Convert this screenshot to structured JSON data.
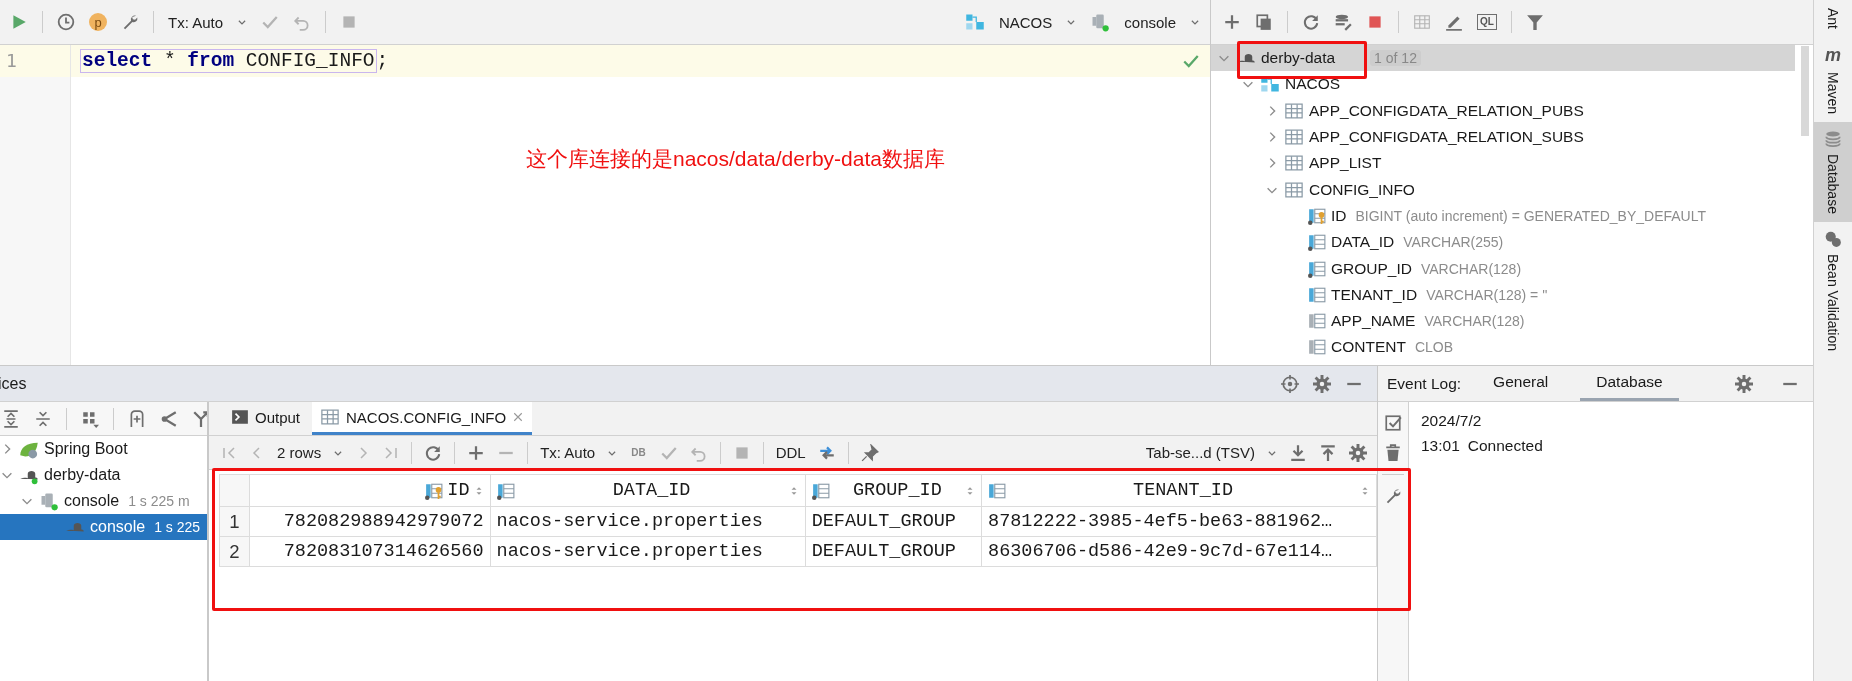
{
  "editor": {
    "toolbar": {
      "profile_badge": "p",
      "tx_mode": "Tx: Auto",
      "datasource": "NACOS",
      "session": "console"
    },
    "lines": [
      {
        "number": "1",
        "tokens": [
          {
            "kind": "keyword",
            "text": "select"
          },
          {
            "kind": "plain",
            "text": " * "
          },
          {
            "kind": "keyword",
            "text": "from"
          },
          {
            "kind": "plain",
            "text": " CONFIG_INFO"
          }
        ],
        "after": ";"
      }
    ],
    "annotation": "这个库连接的是nacos/data/derby-data数据库"
  },
  "database_tree": {
    "toolbar": {
      "console_badge": "QL"
    },
    "root": {
      "label": "derby-data",
      "count": "1 of 12",
      "kind": "datasource",
      "selected": true,
      "expanded": true,
      "children": [
        {
          "label": "NACOS",
          "kind": "schema",
          "expanded": true,
          "children": [
            {
              "label": "APP_CONFIGDATA_RELATION_PUBS",
              "kind": "table",
              "expanded": false
            },
            {
              "label": "APP_CONFIGDATA_RELATION_SUBS",
              "kind": "table",
              "expanded": false
            },
            {
              "label": "APP_LIST",
              "kind": "table",
              "expanded": false
            },
            {
              "label": "CONFIG_INFO",
              "kind": "table",
              "expanded": true,
              "children": [
                {
                  "label": "ID",
                  "type": "BIGINT (auto increment) = GENERATED_BY_DEFAULT",
                  "kind": "key_column"
                },
                {
                  "label": "DATA_ID",
                  "type": "VARCHAR(255)",
                  "kind": "required_column"
                },
                {
                  "label": "GROUP_ID",
                  "type": "VARCHAR(128)",
                  "kind": "required_column"
                },
                {
                  "label": "TENANT_ID",
                  "type": "VARCHAR(128) = ''",
                  "kind": "indexed_column"
                },
                {
                  "label": "APP_NAME",
                  "type": "VARCHAR(128)",
                  "kind": "column"
                },
                {
                  "label": "CONTENT",
                  "type": "CLOB",
                  "kind": "column"
                }
              ]
            }
          ]
        }
      ]
    }
  },
  "tool_strip": [
    {
      "label": "Ant",
      "selected": false
    },
    {
      "glyph": "m",
      "label": "Maven",
      "selected": false
    },
    {
      "label": "Database",
      "selected": true
    },
    {
      "label": "Bean Validation",
      "selected": false
    }
  ],
  "services": {
    "title": "ices",
    "tree": [
      {
        "label": "Spring Boot",
        "kind": "spring",
        "expanded": false,
        "selected": false
      },
      {
        "label": "derby-data",
        "kind": "datasource",
        "expanded": true,
        "selected": false,
        "children": [
          {
            "label": "console",
            "detail": "1 s 225 m",
            "kind": "session",
            "expanded": true,
            "selected": false,
            "children": [
              {
                "label": "console",
                "detail": "1 s 225",
                "kind": "datasource",
                "selected": true
              }
            ]
          }
        ]
      }
    ]
  },
  "results": {
    "tabs": [
      {
        "label": "Output",
        "kind": "output",
        "selected": false
      },
      {
        "label": "NACOS.CONFIG_INFO",
        "kind": "table",
        "selected": true,
        "closable": true
      }
    ],
    "toolbar": {
      "rows": "2 rows",
      "tx_mode": "Tx: Auto",
      "db_badge": "DB",
      "ddl": "DDL",
      "export_format": "Tab-se...d (TSV)"
    },
    "columns": [
      {
        "label": "ID",
        "kind": "key_column"
      },
      {
        "label": "DATA_ID",
        "kind": "required_column"
      },
      {
        "label": "GROUP_ID",
        "kind": "required_column"
      },
      {
        "label": "TENANT_ID",
        "kind": "indexed_column"
      }
    ],
    "rows": [
      {
        "number": "1",
        "cells": [
          "782082988942979072",
          "nacos-service.properties",
          "DEFAULT_GROUP",
          "87812222-3985-4ef5-be63-881962…"
        ]
      },
      {
        "number": "2",
        "cells": [
          "782083107314626560",
          "nacos-service.properties",
          "DEFAULT_GROUP",
          "86306706-d586-42e9-9c7d-67e114…"
        ]
      }
    ]
  },
  "event_log": {
    "title": "Event Log:",
    "tabs": [
      {
        "label": "General",
        "selected": false
      },
      {
        "label": "Database",
        "selected": true
      }
    ],
    "entries": [
      {
        "kind": "date",
        "text": "2024/7/2"
      },
      {
        "kind": "event",
        "time": "13:01",
        "text": "Connected"
      }
    ]
  }
}
